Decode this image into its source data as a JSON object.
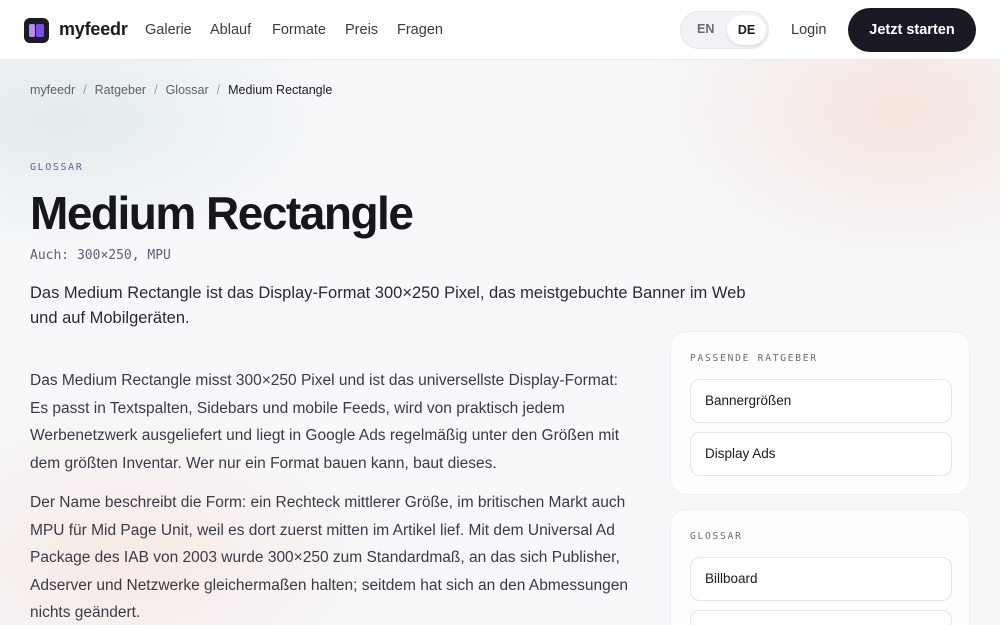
{
  "nav": {
    "brand": "myfeedr",
    "links": [
      "Galerie",
      "Ablauf",
      "Formate",
      "Preis",
      "Fragen"
    ],
    "lang_en": "EN",
    "lang_de": "DE",
    "login": "Login",
    "cta": "Jetzt starten"
  },
  "breadcrumb": [
    "myfeedr",
    "Ratgeber",
    "Glossar",
    "Medium Rectangle"
  ],
  "breadcrumb_separator": "/",
  "article": {
    "kicker": "GLOSSAR",
    "title": "Medium Rectangle",
    "aka": "Auch: 300×250, MPU",
    "lead": "Das Medium Rectangle ist das Display-Format 300×250 Pixel, das meistgebuchte Banner im Web und auf Mobilgeräten.",
    "paragraphs": [
      "Das Medium Rectangle misst 300×250 Pixel und ist das universellste Display-Format: Es passt in Textspalten, Sidebars und mobile Feeds, wird von praktisch jedem Werbenetzwerk ausgeliefert und liegt in Google Ads regelmäßig unter den Größen mit dem größten Inventar. Wer nur ein Format bauen kann, baut dieses.",
      "Der Name beschreibt die Form: ein Rechteck mittlerer Größe, im britischen Markt auch MPU für Mid Page Unit, weil es dort zuerst mitten im Artikel lief. Mit dem Universal Ad Package des IAB von 2003 wurde 300×250 zum Standardmaß, an das sich Publisher, Adserver und Netzwerke gleichermaßen halten; seitdem hat sich an den Abmessungen nichts geändert."
    ]
  },
  "sidebar": {
    "related": {
      "title": "PASSENDE RATGEBER",
      "items": [
        "Bannergrößen",
        "Display Ads"
      ]
    },
    "glossary": {
      "title": "GLOSSAR",
      "items": [
        "Billboard",
        ""
      ]
    }
  },
  "colors": {
    "accent_purple": "#7c4ee8",
    "dark": "#1a1a24"
  }
}
